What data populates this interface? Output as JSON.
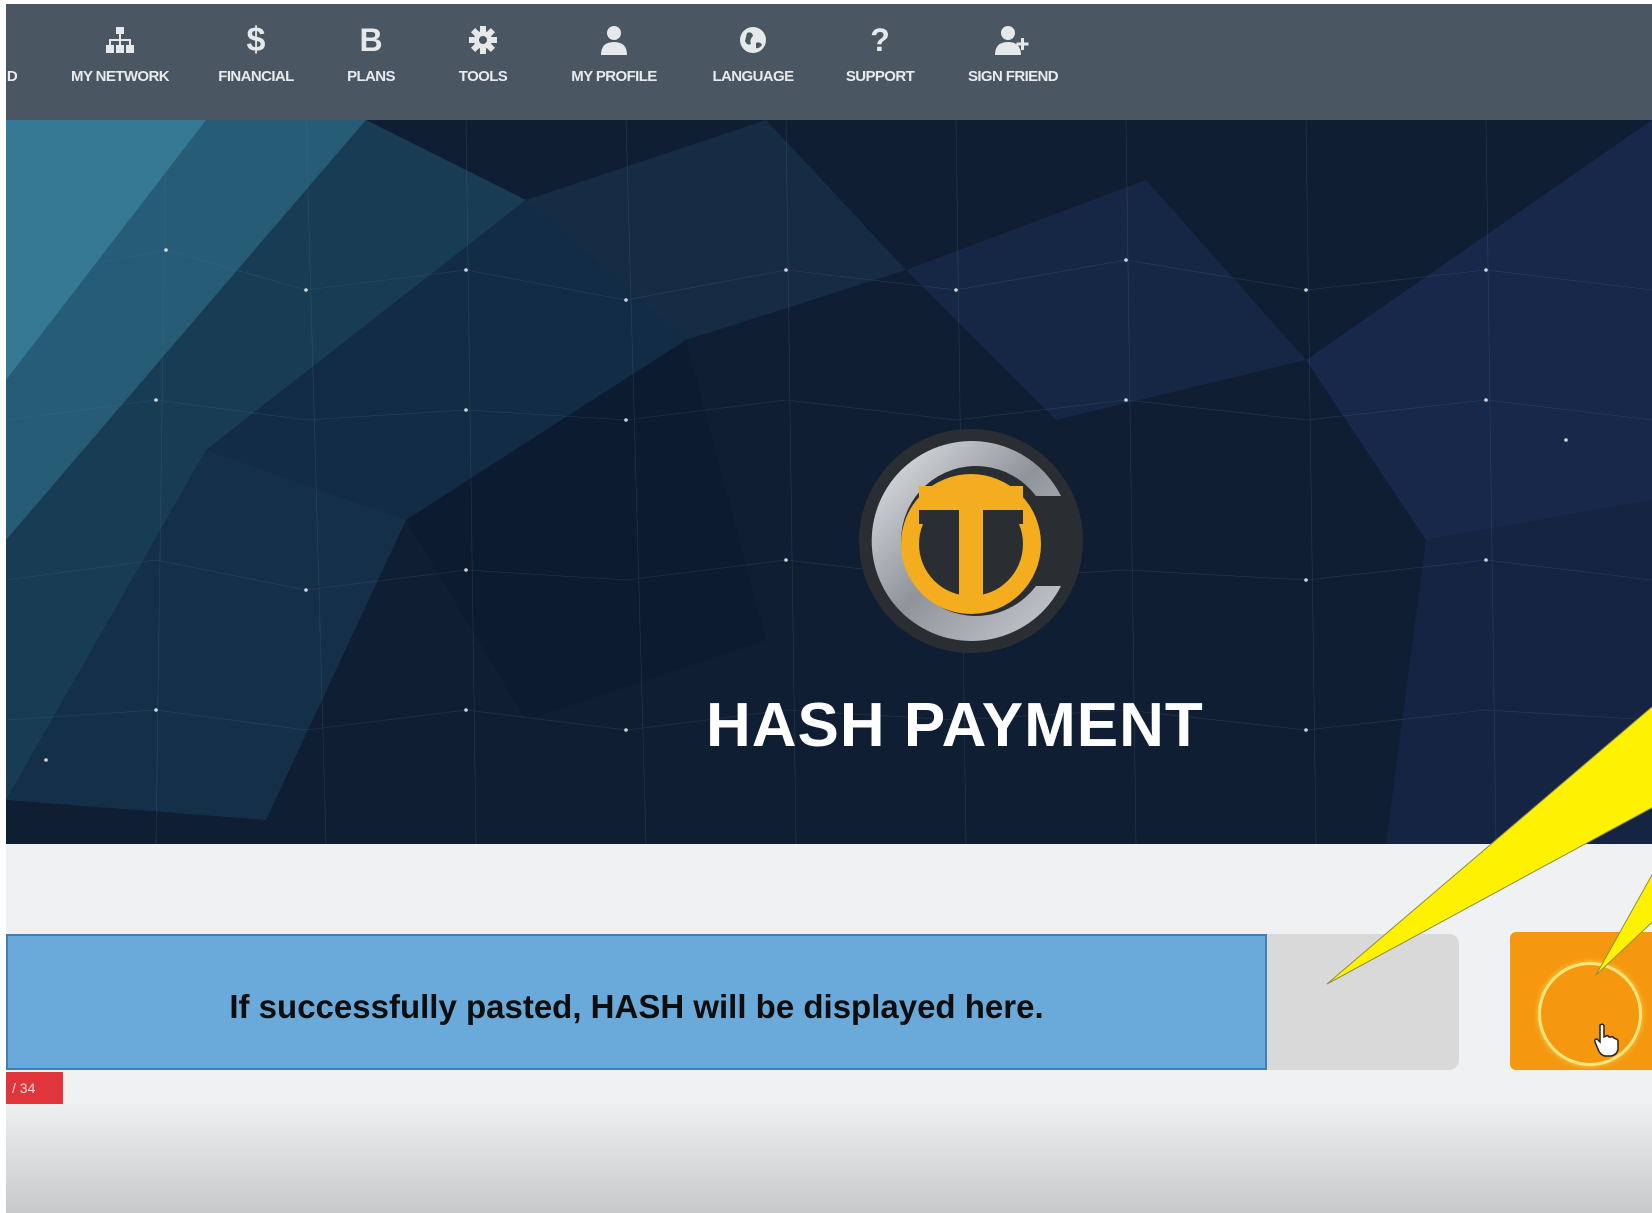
{
  "nav": {
    "items": [
      {
        "label": "D",
        "icon": "dashboard-icon"
      },
      {
        "label": "MY NETWORK",
        "icon": "network-icon"
      },
      {
        "label": "FINANCIAL",
        "icon": "dollar-icon"
      },
      {
        "label": "PLANS",
        "icon": "bitcoin-icon"
      },
      {
        "label": "TOOLS",
        "icon": "gear-icon"
      },
      {
        "label": "MY PROFILE",
        "icon": "user-icon"
      },
      {
        "label": "LANGUAGE",
        "icon": "globe-icon"
      },
      {
        "label": "SUPPORT",
        "icon": "question-icon"
      },
      {
        "label": "SIGN FRIEND",
        "icon": "add-user-icon"
      }
    ]
  },
  "hero": {
    "title": "HASH PAYMENT",
    "logo": "ct-coin-logo"
  },
  "hash": {
    "callout_text": "If successfully pasted, HASH will be displayed here."
  },
  "pagination": {
    "counter": "/ 34"
  },
  "colors": {
    "nav_bg": "#4b5663",
    "hero_bg": "#0e1c30",
    "callout_bg": "#6aaadb",
    "button_accent": "#f5980f",
    "annotation_yellow": "#fff200",
    "badge_red": "#e0353a"
  }
}
